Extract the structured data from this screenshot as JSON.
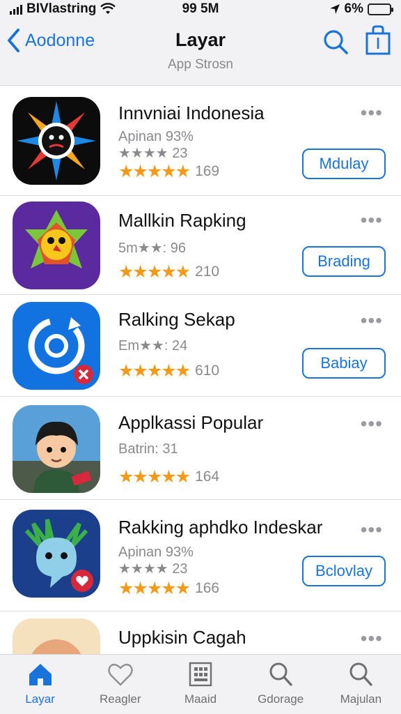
{
  "status_bar": {
    "carrier": "BIVlastring",
    "time": "99 5M",
    "battery": "6%",
    "battery_level": 0.06
  },
  "nav": {
    "back_label": "Aodonne",
    "title": "Layar",
    "subtitle": "App Strosn"
  },
  "apps": [
    {
      "name": "Innvniai Indonesia",
      "meta1": "Apinan 93%",
      "meta2": "★★★★ 23",
      "stars": "★★★★★",
      "rating_count": "169",
      "button": "Mdulay"
    },
    {
      "name": "Mallkin Rapking",
      "meta1": "5m★★: 96",
      "stars": "★★★★★",
      "rating_count": "210",
      "button": "Brading"
    },
    {
      "name": "Ralking Sekap",
      "meta1": "Em★★: 24",
      "stars": "★★★★★",
      "rating_count": "610",
      "button": "Babiay"
    },
    {
      "name": "Applkassi Popular",
      "meta1": "Batrin: 31",
      "stars": "★★★★★",
      "rating_count": "164"
    },
    {
      "name": "Rakking aphdko Indeskar",
      "meta1": "Apinan 93%",
      "meta2": "★★★★ 23",
      "stars": "★★★★★",
      "rating_count": "166",
      "button": "Bclovlay"
    },
    {
      "name": "Uppkisin Cagah"
    }
  ],
  "more_glyph": "•••",
  "tabs": [
    {
      "label": "Layar",
      "icon": "home-icon",
      "active": true
    },
    {
      "label": "Reagler",
      "icon": "heart-icon"
    },
    {
      "label": "Maaid",
      "icon": "grid-icon"
    },
    {
      "label": "Gdorage",
      "icon": "search-icon"
    },
    {
      "label": "Majulan",
      "icon": "search-icon"
    }
  ],
  "colors": {
    "accent": "#1a73d9",
    "star": "#f59a18",
    "bar_bg": "#f2f2f4"
  }
}
